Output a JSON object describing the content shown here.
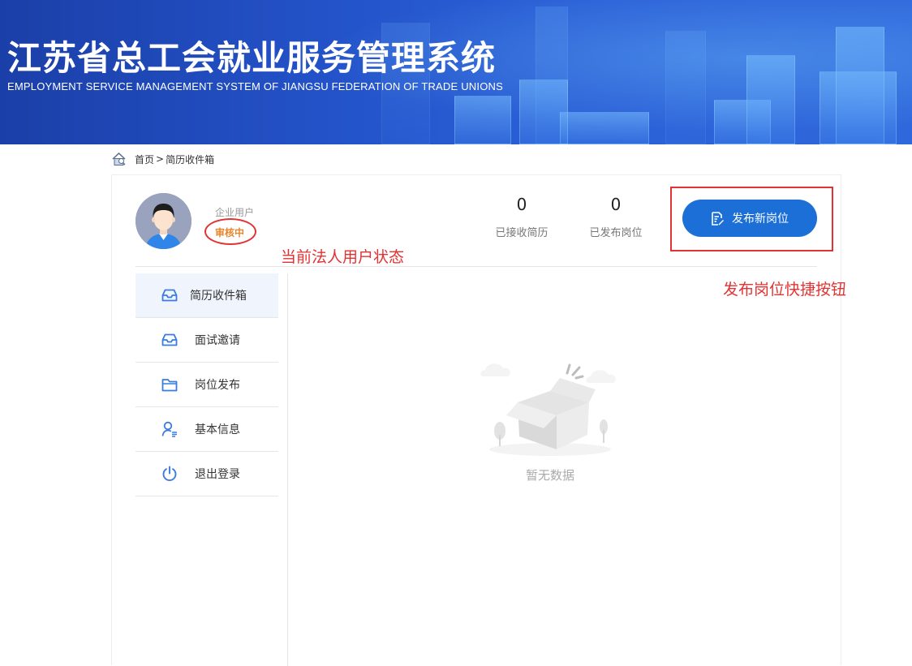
{
  "banner": {
    "title": "江苏省总工会就业服务管理系统",
    "subtitle": "EMPLOYMENT SERVICE MANAGEMENT SYSTEM OF JIANGSU FEDERATION OF TRADE UNIONS"
  },
  "breadcrumb": {
    "home": "首页",
    "separator": ">",
    "current": "简历收件箱"
  },
  "user": {
    "type": "企业用户",
    "status": "审核中",
    "status_color": "#e6862d"
  },
  "stats": [
    {
      "value": "0",
      "label": "已接收简历"
    },
    {
      "value": "0",
      "label": "已发布岗位"
    }
  ],
  "publish_button": {
    "label": "发布新岗位",
    "icon": "document-edit-icon",
    "color": "#1b6fd6"
  },
  "sidebar": {
    "items": [
      {
        "label": "简历收件箱",
        "icon": "inbox-icon",
        "active": true
      },
      {
        "label": "面试邀请",
        "icon": "inbox-icon",
        "active": false
      },
      {
        "label": "岗位发布",
        "icon": "folder-icon",
        "active": false
      },
      {
        "label": "基本信息",
        "icon": "user-info-icon",
        "active": false
      },
      {
        "label": "退出登录",
        "icon": "power-icon",
        "active": false
      }
    ]
  },
  "empty_state": {
    "label": "暂无数据",
    "icon": "empty-box-icon"
  },
  "annotations": {
    "status_note": "当前法人用户状态",
    "publish_note": "发布岗位快捷按钮",
    "color": "#e33232"
  }
}
